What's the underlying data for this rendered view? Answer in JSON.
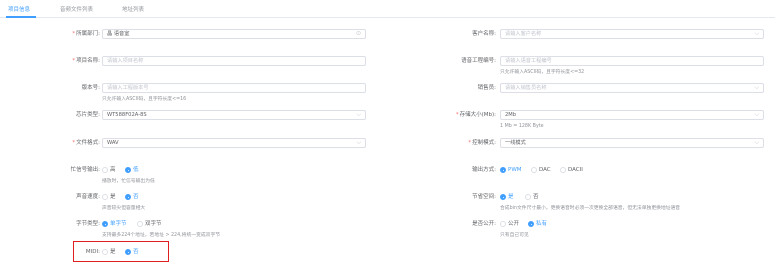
{
  "tabs": [
    "项目信息",
    "音频文件列表",
    "地址列表"
  ],
  "left": {
    "department": {
      "label": "所属部门:",
      "value": "晶 语音室",
      "suffix_icon": "circle-clear-icon"
    },
    "project_name": {
      "label": "项目名称:",
      "placeholder": "请输入项目名称"
    },
    "version": {
      "label": "版本号:",
      "placeholder": "请输入工程版本号",
      "hint": "只允许输入ASCII码，且字符长度<=16"
    },
    "chip_type": {
      "label": "芯片类型:",
      "value": "WT588F02A-8S"
    },
    "file_format": {
      "label": "文件格式:",
      "value": "WAV"
    },
    "busy_output": {
      "label": "忙信号输出:",
      "options": [
        "高",
        "低"
      ],
      "selected": "低",
      "hint": "播放时，忙信号输出为低"
    },
    "voice_speed": {
      "label": "声音速度:",
      "options": [
        "是",
        "否"
      ],
      "selected": "否",
      "hint": "声音较尖但容量相大"
    },
    "byte_type": {
      "label": "字节类型:",
      "options": [
        "单字节",
        "双字节"
      ],
      "selected": "单字节",
      "hint": "支持最多224个地址，若地址 > 224,将统一变成双字节"
    },
    "midi": {
      "label": "MIDI:",
      "options": [
        "是",
        "否"
      ],
      "selected": "否"
    }
  },
  "right": {
    "customer": {
      "label": "客户名称:",
      "placeholder": "请输入客户名称"
    },
    "voice_project_no": {
      "label": "语音工程编号:",
      "placeholder": "请输入语音工程编号",
      "hint": "只允许输入ASCII码，且字符长度<=32"
    },
    "sales": {
      "label": "销售员:",
      "placeholder": "请输入销售员名称"
    },
    "storage": {
      "label": "存储大小(Mb):",
      "value": "2Mb",
      "hint": "1 Mb = 128K Byte"
    },
    "control_mode": {
      "label": "控制模式:",
      "value": "一线模式"
    },
    "output_mode": {
      "label": "输出方式:",
      "options": [
        "PWM",
        "DAC",
        "DACII"
      ],
      "selected": "PWM"
    },
    "save_space": {
      "label": "节省空间:",
      "options": [
        "是",
        "否"
      ],
      "selected": "是",
      "hint": "合成bin文件尺寸最小，更换语音时必须一次更换全部语音，但无法单独更换地址语音"
    },
    "public": {
      "label": "是否公开:",
      "options": [
        "公开",
        "私有"
      ],
      "selected": "私有",
      "hint": "只有自己可见"
    }
  },
  "colors": {
    "primary": "#409eff",
    "required": "#f56c6c",
    "highlight_box": "#e02020"
  }
}
